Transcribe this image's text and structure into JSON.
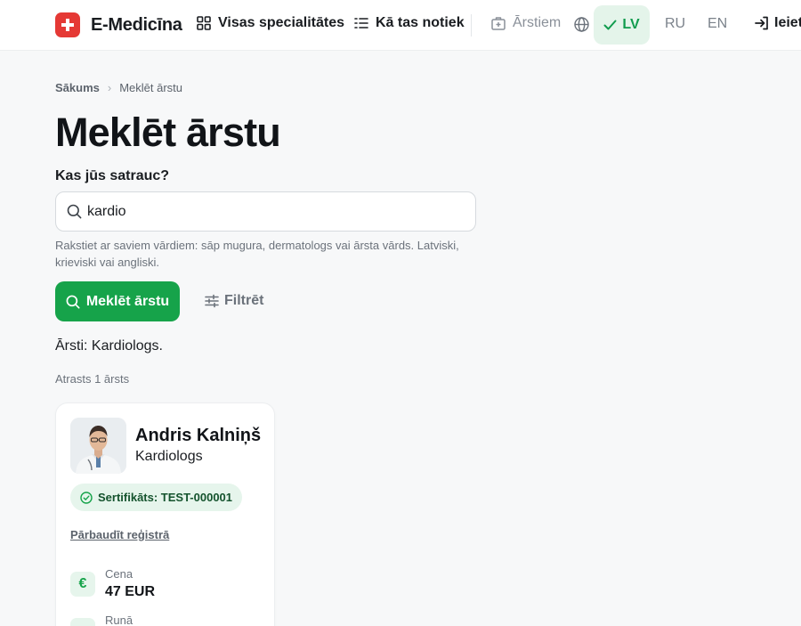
{
  "header": {
    "brand": "E-Medicīna",
    "nav": {
      "specialties": "Visas specialitātes",
      "how_it_works": "Kā tas notiek",
      "for_doctors": "Ārstiem"
    },
    "languages": {
      "lv": "LV",
      "ru": "RU",
      "en": "EN",
      "active": "LV"
    },
    "login": "Ieiet"
  },
  "breadcrumb": {
    "home": "Sākums",
    "current": "Meklēt ārstu"
  },
  "page": {
    "title": "Meklēt ārstu",
    "search_label": "Kas jūs satrauc?",
    "search_value": "kardio",
    "hint": "Rakstiet ar saviem vārdiem: sāp mugura, dermatologs vai ārsta vārds. Latviski, krieviski vai angliski.",
    "search_button": "Meklēt ārstu",
    "filter_button": "Filtrēt",
    "result_summary": "Ārsti: Kardiologs.",
    "result_count": "Atrasts 1 ārsts"
  },
  "doctor": {
    "name": "Andris Kalniņš",
    "specialty": "Kardiologs",
    "certificate": "Sertifikāts: TEST-000001",
    "registry_link": "Pārbaudīt reģistrā",
    "price_label": "Cena",
    "price_value": "47 EUR",
    "language_label": "Runā"
  },
  "colors": {
    "accent": "#16a34a",
    "accent_soft": "#e6f5ec",
    "brand_red": "#e53935",
    "background": "#f7f8f9"
  },
  "icons": {
    "brand": "medical-cross-icon",
    "specialties": "grid-icon",
    "how_it_works": "list-icon",
    "for_doctors": "medical-bag-icon",
    "language": "globe-icon",
    "active_language": "check-icon",
    "login": "login-icon",
    "search": "search-icon",
    "filter": "sliders-icon",
    "certificate": "check-circle-icon",
    "price": "euro-icon"
  }
}
